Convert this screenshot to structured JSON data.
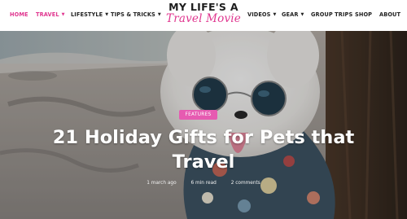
{
  "nav_left": [
    {
      "label": "HOME",
      "active": true
    },
    {
      "label": "TRAVEL",
      "dropdown": true,
      "highlight": true
    },
    {
      "label": "LIFESTYLE",
      "dropdown": true
    },
    {
      "label": "TIPS & TRICKS",
      "dropdown": true
    }
  ],
  "logo": {
    "line1": "MY LIFE'S A",
    "line2": "Travel Movie"
  },
  "nav_right": [
    {
      "label": "VIDEOS",
      "dropdown": true
    },
    {
      "label": "GEAR",
      "dropdown": true
    },
    {
      "label": "GROUP TRIPS"
    },
    {
      "label": "SHOP"
    },
    {
      "label": "ABOUT"
    }
  ],
  "hero": {
    "category": "Features",
    "title": "21 Holiday Gifts for Pets that Travel",
    "meta": {
      "date": "1 march ago",
      "read_time": "6 min read",
      "comments": "2 comments"
    }
  },
  "colors": {
    "accent": "#e0368f",
    "badge": "#e65bb1"
  }
}
